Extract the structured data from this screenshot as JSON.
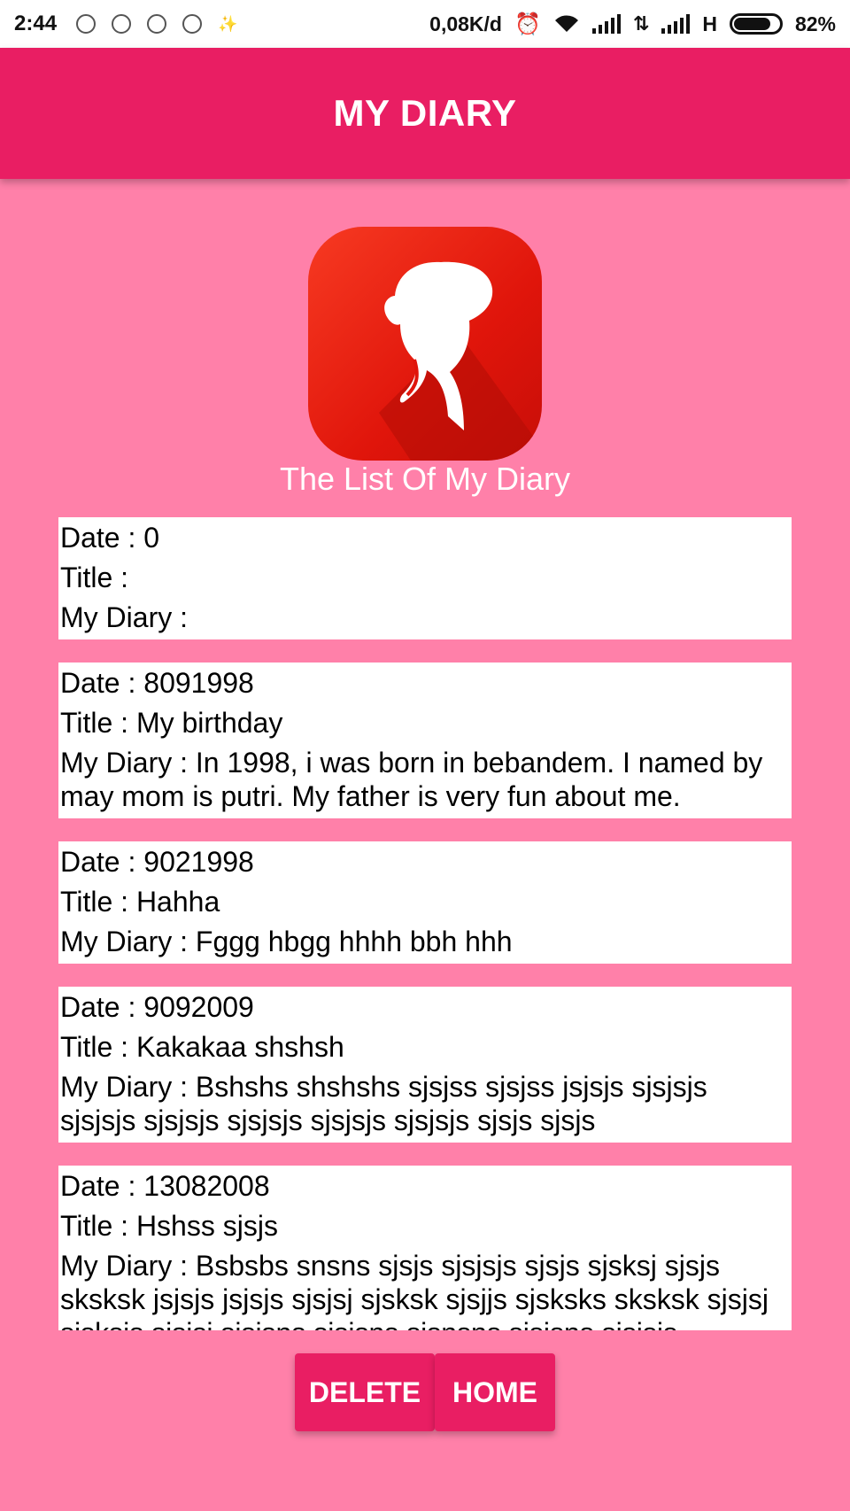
{
  "statusbar": {
    "time": "2:44",
    "speed": "0,08K/d",
    "network": "H",
    "battery": "82%",
    "battery_level": 0.82
  },
  "toolbar": {
    "title": "MY DIARY"
  },
  "logo": {
    "icon": "woman-silhouette-icon",
    "bg_color": "#e0150b"
  },
  "subtitle": "The List Of My Diary",
  "entries": [
    {
      "date": "Date : 0",
      "title": "Title : ",
      "diary": "My Diary : "
    },
    {
      "date": "Date : 8091998",
      "title": "Title : My birthday",
      "diary": "My Diary :  In 1998, i was born in bebandem.  I named by may mom is putri.  My father is very fun about me."
    },
    {
      "date": "Date : 9021998",
      "title": "Title : Hahha",
      "diary": "My Diary :  Fggg hbgg hhhh bbh hhh"
    },
    {
      "date": "Date : 9092009",
      "title": "Title : Kakakaa shshsh",
      "diary": "My Diary :  Bshshs shshshs sjsjss sjsjss jsjsjs sjsjsjs sjsjsjs sjsjsjs sjsjsjs sjsjsjs sjsjsjs sjsjs sjsjs"
    },
    {
      "date": "Date : 13082008",
      "title": "Title : Hshss sjsjs",
      "diary": "My Diary :  Bsbsbs snsns sjsjs sjsjsjs sjsjs sjsksj sjsjs sksksk jsjsjs jsjsjs sjsjsj sjsksk sjsjjs sjsksks sksksk sjsjsj sjsksjs sjsjsj sjsjsns sjsjsns sjsnsns sjsjsns sjsjsjs"
    }
  ],
  "buttons": {
    "delete": "DELETE",
    "home": "HOME"
  },
  "colors": {
    "primary": "#e91e63",
    "background": "#ff80a9",
    "card": "#ffffff"
  }
}
